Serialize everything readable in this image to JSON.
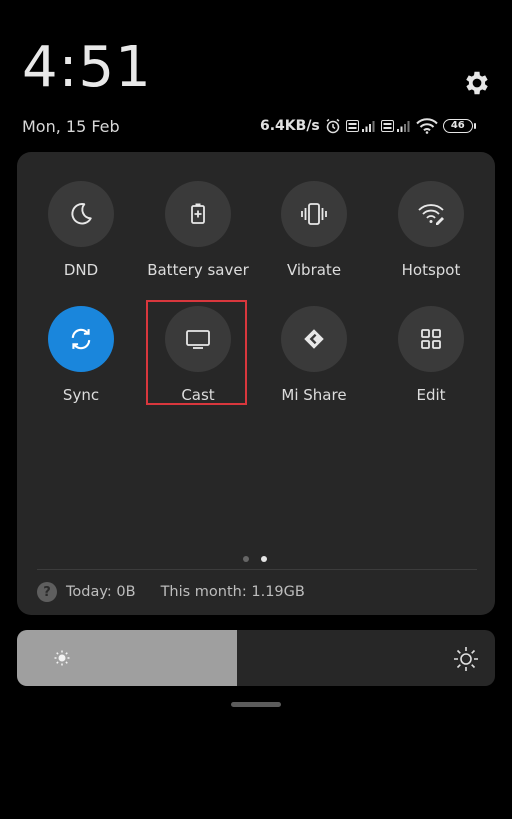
{
  "status": {
    "time": "4:51",
    "date": "Mon, 15 Feb",
    "speed": "6.4KB/s",
    "battery": "46"
  },
  "tiles": [
    {
      "label": "DND",
      "icon": "moon-icon",
      "active": false
    },
    {
      "label": "Battery saver",
      "icon": "battery-saver-icon",
      "active": false
    },
    {
      "label": "Vibrate",
      "icon": "vibrate-icon",
      "active": false
    },
    {
      "label": "Hotspot",
      "icon": "hotspot-icon",
      "active": false
    },
    {
      "label": "Sync",
      "icon": "sync-icon",
      "active": true
    },
    {
      "label": "Cast",
      "icon": "cast-icon",
      "active": false
    },
    {
      "label": "Mi Share",
      "icon": "mi-share-icon",
      "active": false
    },
    {
      "label": "Edit",
      "icon": "grid-icon",
      "active": false
    }
  ],
  "pager": {
    "pages": 2,
    "current": 2
  },
  "data_usage": {
    "today": "Today: 0B",
    "month": "This month: 1.19GB"
  },
  "brightness": {
    "level": 0.46
  },
  "colors": {
    "active_tile": "#1a86dc",
    "highlight": "#d9373d"
  }
}
